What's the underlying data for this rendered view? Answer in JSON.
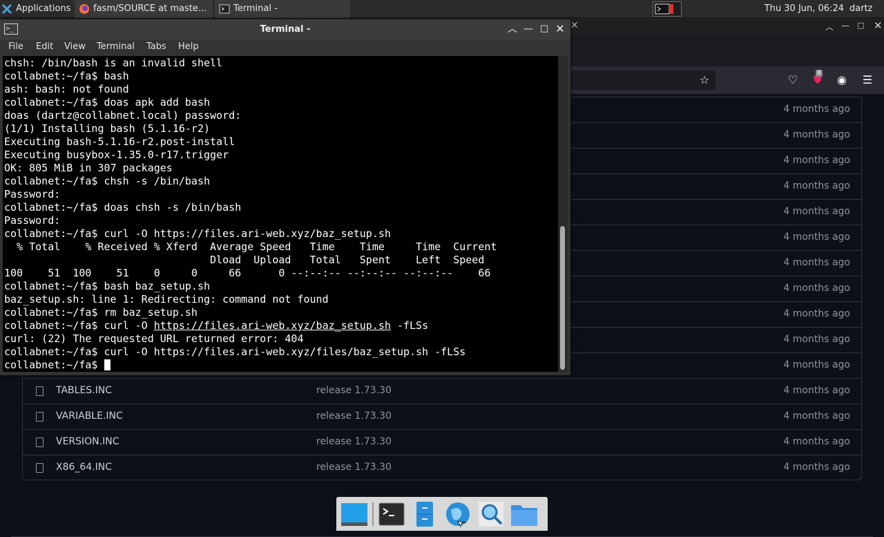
{
  "panel": {
    "apps_label": "Applications",
    "firefox_task": "fasm/SOURCE at maste...",
    "terminal_task": "Terminal -",
    "clock": "Thu 30 Jun, 06:24",
    "user": "dartz"
  },
  "browser": {
    "notification_count": "8",
    "files": [
      {
        "name": "",
        "message": "",
        "age": "4 months ago"
      },
      {
        "name": "",
        "message": "",
        "age": "4 months ago"
      },
      {
        "name": "",
        "message": "",
        "age": "4 months ago"
      },
      {
        "name": "",
        "message": "",
        "age": "4 months ago"
      },
      {
        "name": "",
        "message": "",
        "age": "4 months ago"
      },
      {
        "name": "",
        "message": "",
        "age": "4 months ago"
      },
      {
        "name": "",
        "message": "",
        "age": "4 months ago"
      },
      {
        "name": "",
        "message": "",
        "age": "4 months ago"
      },
      {
        "name": "",
        "message": "",
        "age": "4 months ago"
      },
      {
        "name": "",
        "message": "",
        "age": "4 months ago"
      },
      {
        "name": "",
        "message": "",
        "age": "4 months ago"
      },
      {
        "name": "TABLES.INC",
        "message": "release 1.73.30",
        "age": "4 months ago"
      },
      {
        "name": "VARIABLE.INC",
        "message": "release 1.73.30",
        "age": "4 months ago"
      },
      {
        "name": "VERSION.INC",
        "message": "release 1.73.30",
        "age": "4 months ago"
      },
      {
        "name": "X86_64.INC",
        "message": "release 1.73.30",
        "age": "4 months ago"
      }
    ]
  },
  "terminal": {
    "title": "Terminal -",
    "menu": [
      "File",
      "Edit",
      "View",
      "Terminal",
      "Tabs",
      "Help"
    ],
    "lines": [
      "chsh: /bin/bash is an invalid shell",
      "collabnet:~/fa$ bash",
      "ash: bash: not found",
      "collabnet:~/fa$ doas apk add bash",
      "doas (dartz@collabnet.local) password:",
      "(1/1) Installing bash (5.1.16-r2)",
      "Executing bash-5.1.16-r2.post-install",
      "Executing busybox-1.35.0-r17.trigger",
      "OK: 805 MiB in 307 packages",
      "collabnet:~/fa$ chsh -s /bin/bash",
      "Password:",
      "collabnet:~/fa$ doas chsh -s /bin/bash",
      "Password:",
      "collabnet:~/fa$ curl -O https://files.ari-web.xyz/baz_setup.sh",
      "  % Total    % Received % Xferd  Average Speed   Time    Time     Time  Current",
      "                                 Dload  Upload   Total   Spent    Left  Speed",
      "100    51  100    51    0     0     66      0 --:--:-- --:--:-- --:--:--    66",
      "collabnet:~/fa$ bash baz_setup.sh",
      "baz_setup.sh: line 1: Redirecting: command not found",
      "collabnet:~/fa$ rm baz_setup.sh",
      "",
      "curl: (22) The requested URL returned error: 404",
      "collabnet:~/fa$ curl -O https://files.ari-web.xyz/files/baz_setup.sh -fLSs",
      "collabnet:~/fa$ "
    ],
    "line21_prefix": "collabnet:~/fa$ curl -O ",
    "line21_link": "https://files.ari-web.xyz/baz_setup.sh",
    "line21_suffix": " -fLSs"
  }
}
